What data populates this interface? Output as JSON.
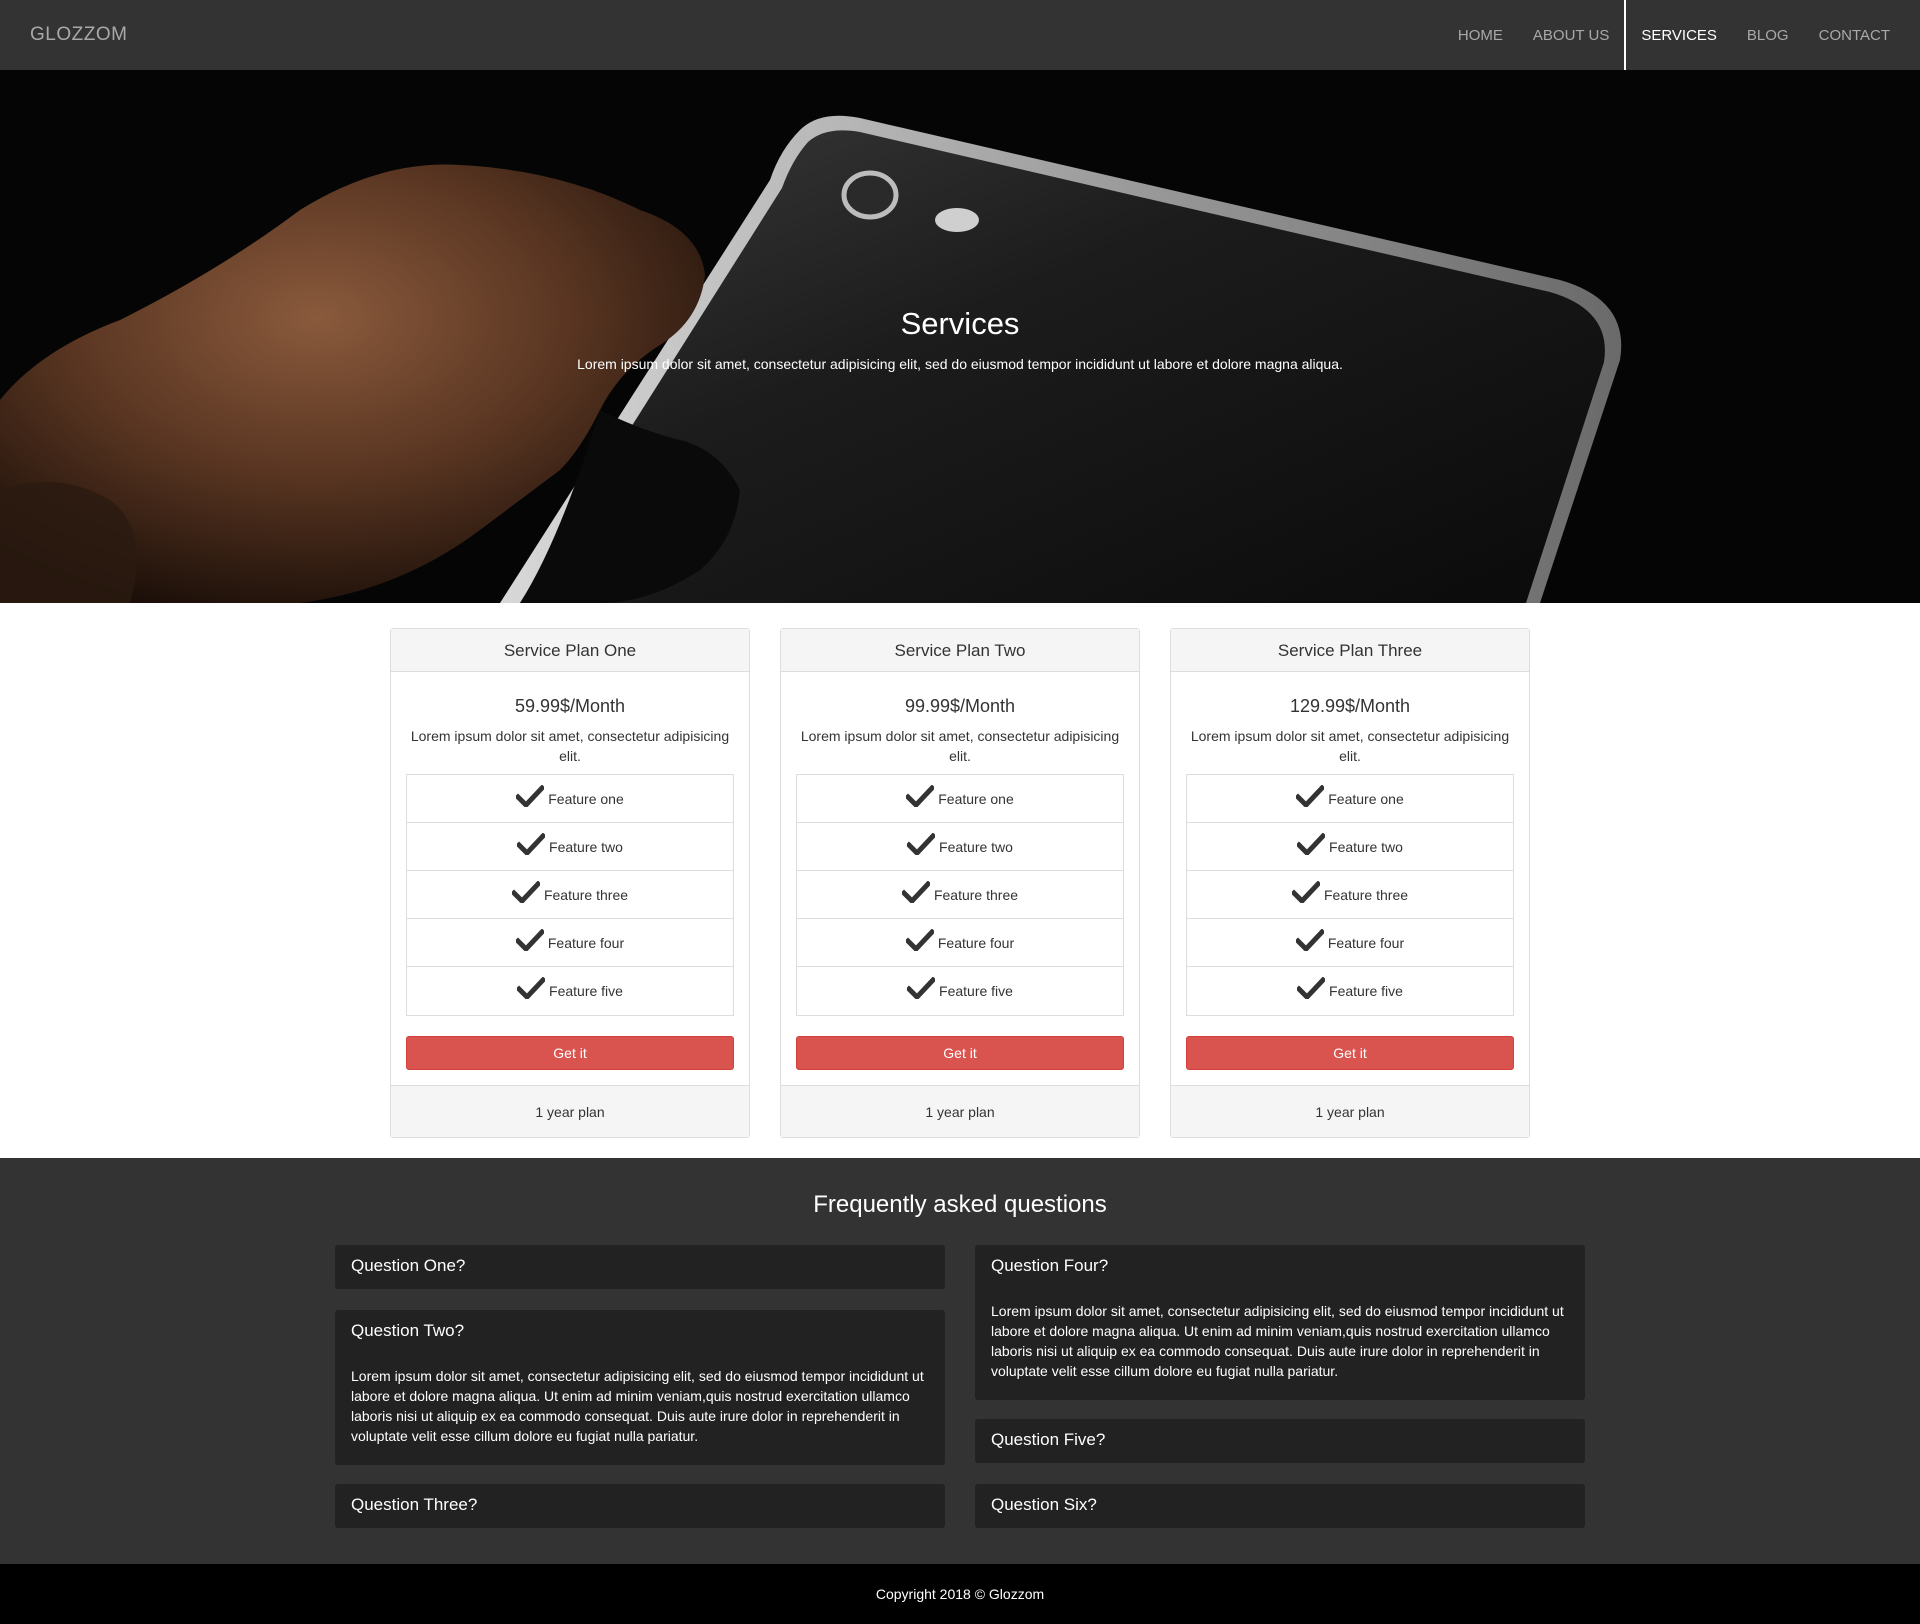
{
  "nav": {
    "brand": "GLOZZOM",
    "items": [
      {
        "label": "HOME"
      },
      {
        "label": "ABOUT US"
      },
      {
        "label": "SERVICES"
      },
      {
        "label": "BLOG"
      },
      {
        "label": "CONTACT"
      }
    ],
    "active": "SERVICES"
  },
  "hero": {
    "title": "Services",
    "subtitle": "Lorem ipsum dolor sit amet, consectetur adipisicing elit, sed do eiusmod tempor incididunt ut labore et dolore magna aliqua."
  },
  "plans": [
    {
      "name": "Service Plan One",
      "price": "59.99$/Month",
      "description": "Lorem ipsum dolor sit amet, consectetur adipisicing elit.",
      "features": [
        "Feature one",
        "Feature two",
        "Feature three",
        "Feature four",
        "Feature five"
      ],
      "button": "Get it",
      "footer": "1 year plan"
    },
    {
      "name": "Service Plan Two",
      "price": "99.99$/Month",
      "description": "Lorem ipsum dolor sit amet, consectetur adipisicing elit.",
      "features": [
        "Feature one",
        "Feature two",
        "Feature three",
        "Feature four",
        "Feature five"
      ],
      "button": "Get it",
      "footer": "1 year plan"
    },
    {
      "name": "Service Plan Three",
      "price": "129.99$/Month",
      "description": "Lorem ipsum dolor sit amet, consectetur adipisicing elit.",
      "features": [
        "Feature one",
        "Feature two",
        "Feature three",
        "Feature four",
        "Feature five"
      ],
      "button": "Get it",
      "footer": "1 year plan"
    }
  ],
  "faq": {
    "title": "Frequently asked questions",
    "left": [
      {
        "question": "Question One?"
      },
      {
        "question": "Question Two?",
        "answer": "Lorem ipsum dolor sit amet, consectetur adipisicing elit, sed do eiusmod tempor incididunt ut labore et dolore magna aliqua. Ut enim ad minim veniam,quis nostrud exercitation ullamco laboris nisi ut aliquip ex ea commodo consequat. Duis aute irure dolor in reprehenderit in voluptate velit esse cillum dolore eu fugiat nulla pariatur."
      },
      {
        "question": "Question Three?"
      }
    ],
    "right": [
      {
        "question": "Question Four?",
        "answer": "Lorem ipsum dolor sit amet, consectetur adipisicing elit, sed do eiusmod tempor incididunt ut labore et dolore magna aliqua. Ut enim ad minim veniam,quis nostrud exercitation ullamco laboris nisi ut aliquip ex ea commodo consequat. Duis aute irure dolor in reprehenderit in voluptate velit esse cillum dolore eu fugiat nulla pariatur."
      },
      {
        "question": "Question Five?"
      },
      {
        "question": "Question Six?"
      }
    ]
  },
  "footer": {
    "copyright": "Copyright 2018 © Glozzom"
  },
  "colors": {
    "navbar": "#333333",
    "accent_button": "#d9534f",
    "faq_bg": "#333333",
    "faq_panel": "#222222",
    "footer_bg": "#000000"
  },
  "icons": {
    "feature": "check-icon"
  }
}
